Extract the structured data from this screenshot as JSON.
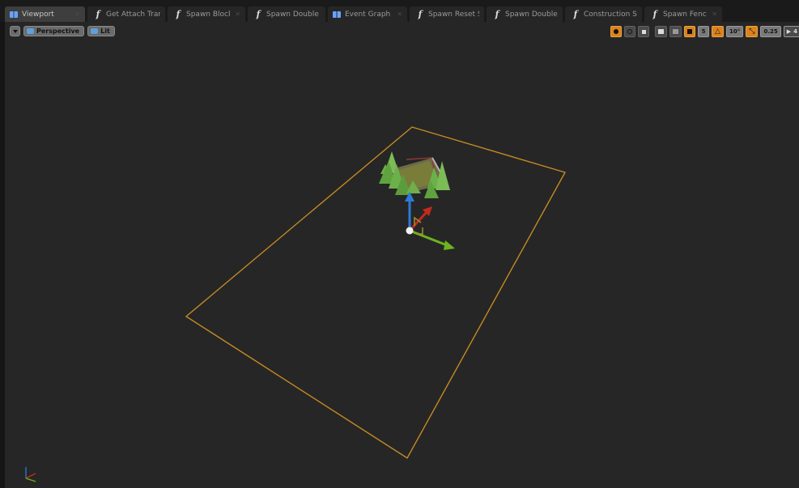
{
  "tabs": [
    {
      "label": "Viewport",
      "icon": "viewport-grid-icon",
      "active": true
    },
    {
      "label": "Get Attach Transfo",
      "icon": "function-icon"
    },
    {
      "label": "Spawn Blocker",
      "icon": "function-icon"
    },
    {
      "label": "Spawn Double Life",
      "icon": "function-icon"
    },
    {
      "label": "Event Graph",
      "icon": "event-graph-icon"
    },
    {
      "label": "Spawn Reset Speei",
      "icon": "function-icon"
    },
    {
      "label": "Spawn Double Coin",
      "icon": "function-icon"
    },
    {
      "label": "Construction Scrip",
      "icon": "function-icon"
    },
    {
      "label": "Spawn Fence",
      "icon": "function-icon"
    }
  ],
  "toolbar": {
    "view_mode": "Perspective",
    "lighting": "Lit",
    "grid_snap": "5",
    "rotation_snap": "10°",
    "scale_snap": "0.25",
    "camera_speed": "4"
  },
  "colors": {
    "accent": "#d9831f",
    "bounds": "#c48a23",
    "gizmo_z": "#2e7ad6",
    "gizmo_x": "#c42a1c",
    "gizmo_y": "#6fb21d"
  }
}
